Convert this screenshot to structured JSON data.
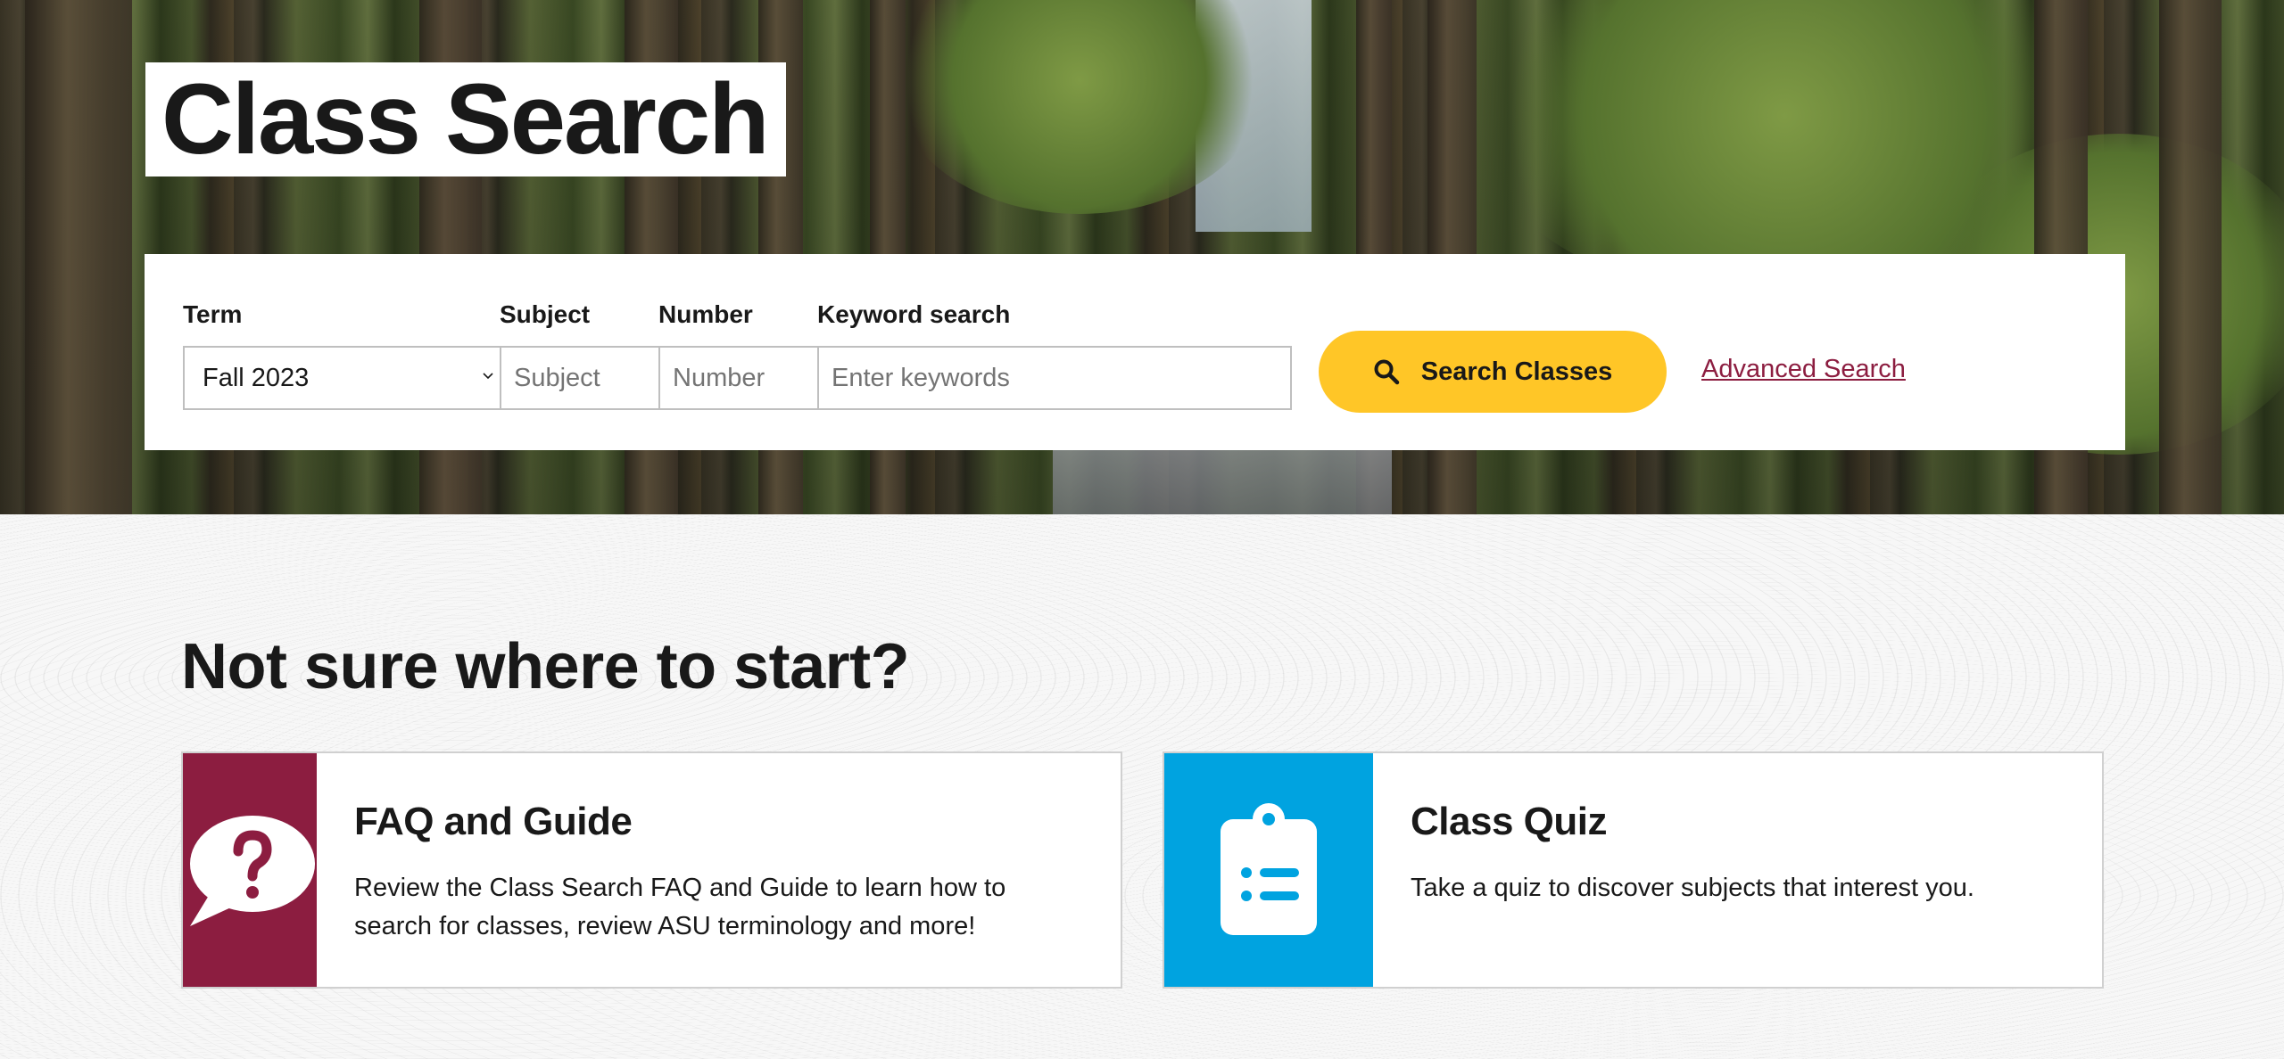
{
  "hero": {
    "title": "Class Search"
  },
  "search_form": {
    "term": {
      "label": "Term",
      "value": "Fall 2023"
    },
    "subject": {
      "label": "Subject",
      "placeholder": "Subject"
    },
    "number": {
      "label": "Number",
      "placeholder": "Number"
    },
    "keyword": {
      "label": "Keyword search",
      "placeholder": "Enter keywords"
    },
    "search_button": {
      "label": "Search Classes",
      "icon": "search-icon"
    },
    "advanced_link": "Advanced Search"
  },
  "help_section": {
    "heading": "Not sure where to start?",
    "cards": [
      {
        "title": "FAQ and Guide",
        "text": "Review the Class Search FAQ and Guide to learn how to search for classes, review ASU terminology and more!",
        "icon": "question-bubble-icon",
        "color": "#8c1d40"
      },
      {
        "title": "Class Quiz",
        "text": "Take a quiz to discover subjects that interest you.",
        "icon": "clipboard-list-icon",
        "color": "#00a3e0"
      }
    ]
  },
  "colors": {
    "accent_gold": "#ffc627",
    "maroon": "#8c1d40",
    "blue": "#00a3e0",
    "text": "#191919"
  }
}
